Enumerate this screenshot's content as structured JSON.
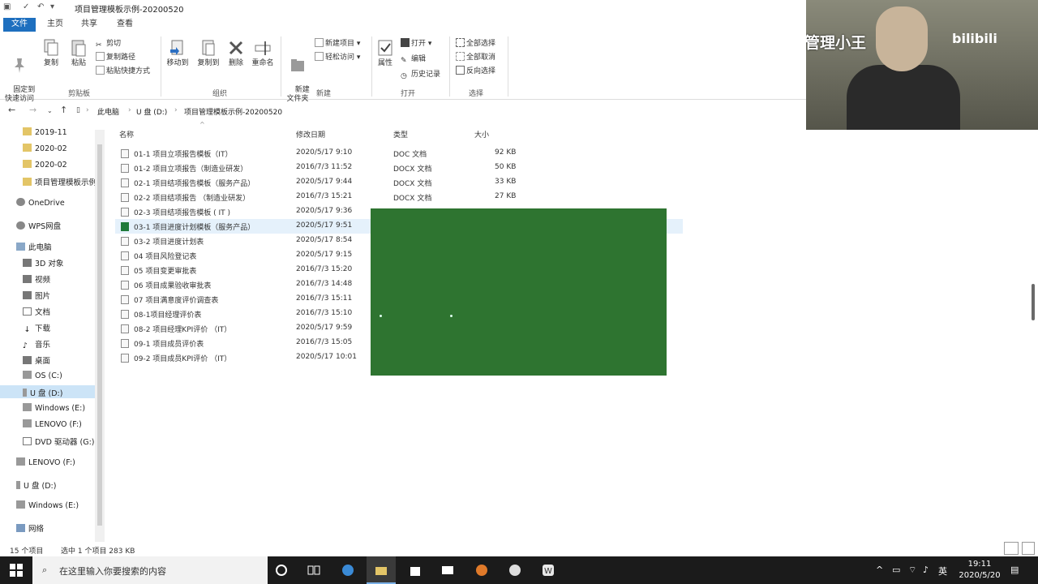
{
  "window": {
    "title": "项目管理模板示例-20200520",
    "quick_access": [
      "✓",
      "▾"
    ]
  },
  "tabs": [
    {
      "label": "文件",
      "active": true
    },
    {
      "label": "主页",
      "active": false
    },
    {
      "label": "共享",
      "active": false
    },
    {
      "label": "查看",
      "active": false
    }
  ],
  "ribbon": {
    "clipboard": {
      "pin_label": "固定到\n快速访问",
      "copy_label": "复制",
      "paste_label": "粘贴",
      "cut_label": "剪切",
      "copy_path_label": "复制路径",
      "paste_shortcut_label": "粘贴快捷方式",
      "group_label": "剪贴板"
    },
    "organize": {
      "move_to_label": "移动到",
      "copy_to_label": "复制到",
      "delete_label": "删除",
      "rename_label": "重命名",
      "group_label": "组织"
    },
    "new": {
      "new_folder_label": "新建\n文件夹",
      "new_item_label": "新建项目",
      "easy_access_label": "轻松访问",
      "group_label": "新建"
    },
    "open": {
      "properties_label": "属性",
      "open_label": "打开",
      "edit_label": "编辑",
      "history_label": "历史记录",
      "group_label": "打开"
    },
    "select": {
      "select_all_label": "全部选择",
      "select_none_label": "全部取消",
      "invert_label": "反向选择",
      "group_label": "选择"
    }
  },
  "address": {
    "crumbs": [
      "此电脑",
      "U 盘 (D:)",
      "项目管理模板示例-20200520"
    ]
  },
  "nav_pane": {
    "items": [
      {
        "label": "2019-11",
        "icon": "folder-icon"
      },
      {
        "label": "2020-02",
        "icon": "folder-icon"
      },
      {
        "label": "2020-02",
        "icon": "folder-icon"
      },
      {
        "label": "项目管理模板示例",
        "icon": "folder-icon"
      },
      {
        "label": "OneDrive",
        "icon": "cloud-icon"
      },
      {
        "label": "WPS网盘",
        "icon": "cloud-icon"
      },
      {
        "label": "此电脑",
        "icon": "computer-icon"
      },
      {
        "label": "3D 对象",
        "icon": "cube-icon"
      },
      {
        "label": "视频",
        "icon": "video-icon"
      },
      {
        "label": "图片",
        "icon": "picture-icon"
      },
      {
        "label": "文档",
        "icon": "document-icon"
      },
      {
        "label": "下载",
        "icon": "download-icon"
      },
      {
        "label": "音乐",
        "icon": "music-icon"
      },
      {
        "label": "桌面",
        "icon": "desktop-icon"
      },
      {
        "label": "OS (C:)",
        "icon": "drive-icon"
      },
      {
        "label": "U 盘 (D:)",
        "icon": "usb-drive-icon"
      },
      {
        "label": "Windows (E:)",
        "icon": "drive-icon"
      },
      {
        "label": "LENOVO (F:)",
        "icon": "drive-icon"
      },
      {
        "label": "DVD 驱动器 (G:)",
        "icon": "dvd-icon"
      },
      {
        "label": "LENOVO (F:)",
        "icon": "drive-icon"
      },
      {
        "label": "U 盘 (D:)",
        "icon": "usb-drive-icon"
      },
      {
        "label": "Windows (E:)",
        "icon": "drive-icon"
      },
      {
        "label": "网络",
        "icon": "network-icon"
      }
    ]
  },
  "columns": {
    "name": "名称",
    "date": "修改日期",
    "type": "类型",
    "size": "大小"
  },
  "files": [
    {
      "name": "01-1  项目立项报告模板（IT）",
      "date": "2020/5/17 9:10",
      "type": "DOC 文档",
      "size": "92 KB"
    },
    {
      "name": "01-2 项目立项报告（制造业研发）",
      "date": "2016/7/3 11:52",
      "type": "DOCX 文档",
      "size": "50 KB"
    },
    {
      "name": "02-1 项目结项报告模板（服务产品）",
      "date": "2020/5/17 9:44",
      "type": "DOCX 文档",
      "size": "33 KB"
    },
    {
      "name": "02-2 项目结项报告 （制造业研发）",
      "date": "2016/7/3 15:21",
      "type": "DOCX 文档",
      "size": "27 KB"
    },
    {
      "name": "02-3 项目结项报告模板 ( IT )",
      "date": "2020/5/17 9:36",
      "type": "",
      "size": ""
    },
    {
      "name": "03-1 项目进度计划模板（服务产品）",
      "date": "2020/5/17 9:51",
      "type": "",
      "size": ""
    },
    {
      "name": "03-2 项目进度计划表",
      "date": "2020/5/17 8:54",
      "type": "",
      "size": ""
    },
    {
      "name": "04 项目风险登记表",
      "date": "2020/5/17 9:15",
      "type": "",
      "size": ""
    },
    {
      "name": "05 项目变更审批表",
      "date": "2016/7/3 15:20",
      "type": "",
      "size": ""
    },
    {
      "name": "06 项目成果验收审批表",
      "date": "2016/7/3 14:48",
      "type": "",
      "size": ""
    },
    {
      "name": "07 项目满意度评价调查表",
      "date": "2016/7/3 15:11",
      "type": "",
      "size": ""
    },
    {
      "name": "08-1项目经理评价表",
      "date": "2016/7/3 15:10",
      "type": "",
      "size": ""
    },
    {
      "name": "08-2 项目经理KPI评价 （IT）",
      "date": "2020/5/17 9:59",
      "type": "",
      "size": ""
    },
    {
      "name": "09-1 项目成员评价表",
      "date": "2016/7/3 15:05",
      "type": "",
      "size": ""
    },
    {
      "name": "09-2 项目成员KPI评价 （IT）",
      "date": "2020/5/17 10:01",
      "type": "",
      "size": ""
    }
  ],
  "status": {
    "count": "15 个项目",
    "selected": "选中 1 个项目  283 KB"
  },
  "webcam": {
    "watermark": "项目管理小王",
    "brand": "bilibili"
  },
  "taskbar": {
    "search_placeholder": "在这里输入你要搜索的内容",
    "ime": "英",
    "time": "19:11",
    "date": "2020/5/20"
  },
  "colors": {
    "accent": "#1e6fbf",
    "overlay_green": "#2e7430",
    "selection": "#cce4f7"
  }
}
